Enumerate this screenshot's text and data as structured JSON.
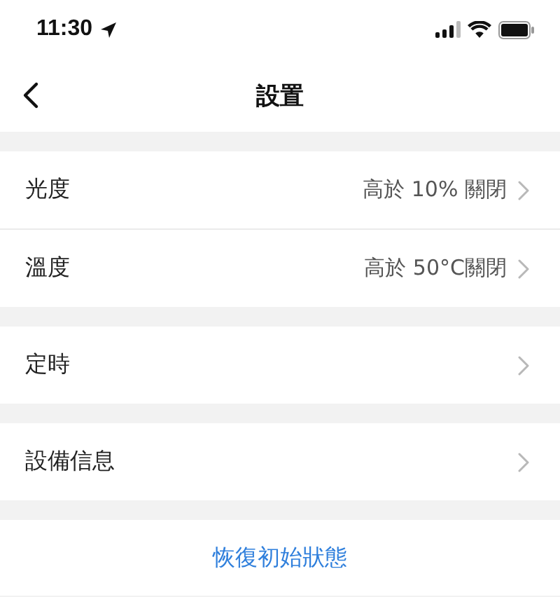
{
  "status_bar": {
    "time": "11:30"
  },
  "nav": {
    "title": "設置"
  },
  "groups": [
    {
      "rows": [
        {
          "label": "光度",
          "value": "高於 10% 關閉"
        },
        {
          "label": "溫度",
          "value": "高於 50°C關閉"
        }
      ]
    },
    {
      "rows": [
        {
          "label": "定時"
        }
      ]
    },
    {
      "rows": [
        {
          "label": "設備信息"
        }
      ]
    }
  ],
  "reset": "恢復初始狀態"
}
